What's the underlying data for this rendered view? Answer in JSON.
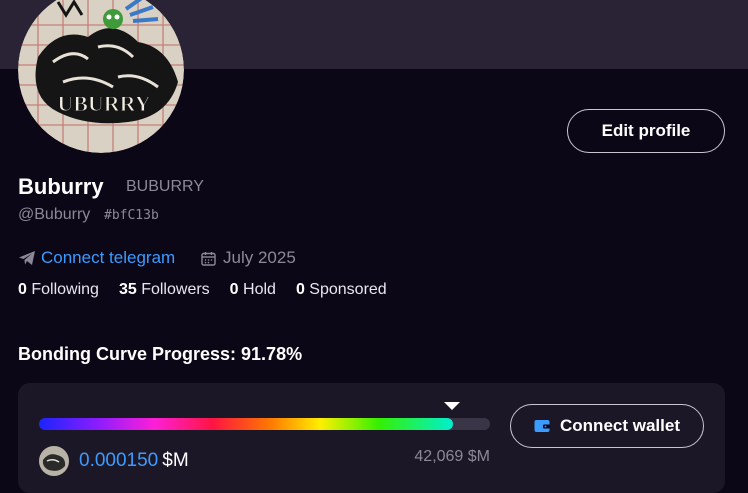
{
  "profile": {
    "name": "Buburry",
    "ticker": "BUBURRY",
    "handle": "@Buburry",
    "hash": "#bfC13b",
    "avatar_text": "UBURRY",
    "edit_label": "Edit profile"
  },
  "links": {
    "telegram_label": "Connect telegram",
    "joined": "July 2025",
    "icons": [
      "telegram-icon",
      "calendar-icon"
    ]
  },
  "stats": [
    {
      "count": "0",
      "label": "Following"
    },
    {
      "count": "35",
      "label": "Followers"
    },
    {
      "count": "0",
      "label": "Hold"
    },
    {
      "count": "0",
      "label": "Sponsored"
    }
  ],
  "bonding": {
    "title": "Bonding Curve Progress: 91.78%",
    "progress_percent": 91.78,
    "price_value": "0.000150",
    "price_unit": "$M",
    "market_cap": "42,069 $M",
    "wallet_label": "Connect wallet"
  },
  "colors": {
    "background": "#0c0717",
    "banner": "#2a2235",
    "accent_blue": "#3b9bff",
    "muted": "#8d8898",
    "card": "#1c1727"
  }
}
